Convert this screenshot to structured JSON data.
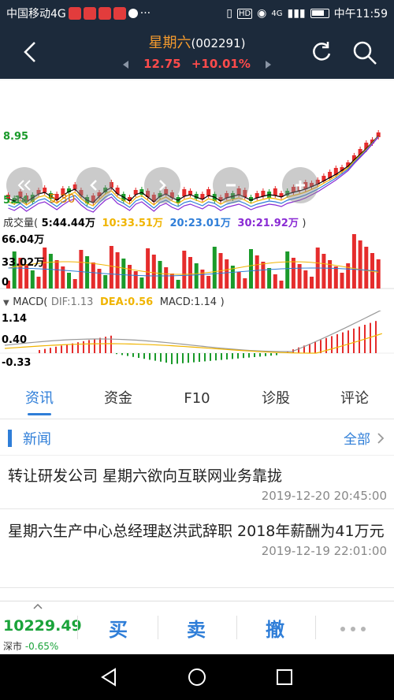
{
  "status_bar": {
    "carrier": "中国移动4G",
    "network": "4G",
    "time": "中午11:59"
  },
  "header": {
    "stock_name": "星期六",
    "stock_code": "(002291)",
    "price": "12.75",
    "change": "+10.01%"
  },
  "chart": {
    "price_labels": {
      "high": "8.95",
      "low": "5.14",
      "low_marker": "5.30"
    },
    "volume": {
      "title": "成交量(",
      "v5": "5:44.44万",
      "v10": "10:33.51万",
      "v20": "20:23.01万",
      "v30": "30:21.92万",
      "close": ")",
      "ticks": [
        "66.04万",
        "33.02万",
        "0"
      ]
    },
    "macd": {
      "title": "MACD(",
      "dif": "DIF:1.13",
      "dea": "DEA:0.56",
      "macd": "MACD:1.14",
      "close": ")",
      "ticks": [
        "1.14",
        "0.40",
        "-0.33"
      ]
    },
    "colors": {
      "up": "#e52c2c",
      "down": "#1a9a2a",
      "ma5": "#000000",
      "ma10": "#f0b400",
      "ma20": "#2f7ed8",
      "ma30": "#8a2bd4"
    }
  },
  "tabs": [
    "资讯",
    "资金",
    "F10",
    "诊股",
    "评论"
  ],
  "news_section": {
    "title": "新闻",
    "all_label": "全部"
  },
  "news": [
    {
      "title": "转让研发公司 星期六欲向互联网业务靠拢",
      "date": "2019-12-20 20:45:00"
    },
    {
      "title": "星期六生产中心总经理赵洪武辞职 2018年薪酬为41万元",
      "date": "2019-12-19 22:01:00"
    }
  ],
  "bottom_bar": {
    "index_value": "10229.49",
    "index_market": "深市",
    "index_change": "-0.65%",
    "buy": "买",
    "sell": "卖",
    "cancel": "撤"
  },
  "nav_icons": [
    "back-icon",
    "home-icon",
    "recents-icon"
  ]
}
